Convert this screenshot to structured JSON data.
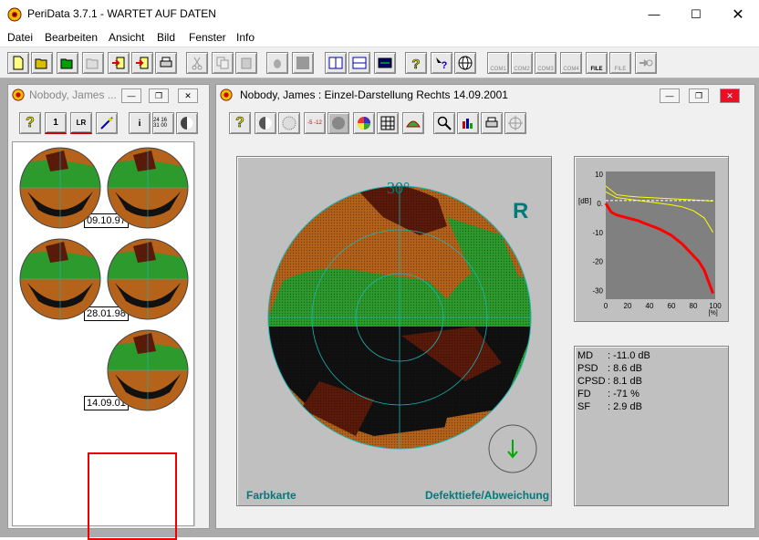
{
  "window": {
    "title": "PeriData 3.7.1 - WARTET AUF DATEN"
  },
  "menu": [
    "Datei",
    "Bearbeiten",
    "Ansicht",
    "Bild",
    "Fenster",
    "Info"
  ],
  "toolbar": {
    "com_buttons": [
      "COM1",
      "COM2",
      "COM3",
      "COM4",
      "FILE",
      "FILE"
    ]
  },
  "left_window": {
    "title": "Nobody, James ...",
    "buttons": [
      "?",
      "1",
      "LR",
      "i",
      "24 16 31 00"
    ],
    "thumbs": [
      {
        "date": "09.10.97"
      },
      {
        "date": "28.01.98"
      },
      {
        "date": "14.09.01"
      }
    ]
  },
  "right_window": {
    "title": "Nobody, James :  Einzel-Darstellung  Rechts  14.09.2001",
    "toolbar": [
      "?",
      "-5 -12"
    ],
    "map": {
      "angle": "30°",
      "eye": "R",
      "left_label": "Farbkarte",
      "right_label": "Defekttiefe/Abweichung"
    },
    "chart_data": {
      "type": "line",
      "title": "",
      "xlabel": "[%]",
      "ylabel": "[dB]",
      "xlim": [
        0,
        100
      ],
      "ylim": [
        -33,
        11
      ],
      "x_ticks": [
        "0",
        "20",
        "40",
        "60",
        "80",
        "100"
      ],
      "y_ticks": [
        "10",
        "0.",
        "-10",
        "-20",
        "-30"
      ],
      "series": [
        {
          "color": "#ff0000",
          "x": [
            0,
            5,
            10,
            15,
            20,
            25,
            30,
            35,
            40,
            45,
            50,
            55,
            60,
            65,
            70,
            75,
            80,
            85,
            90,
            95,
            98
          ],
          "y": [
            0,
            -3,
            -4,
            -4.5,
            -5,
            -5.5,
            -6,
            -6.8,
            -7.5,
            -8.2,
            -9,
            -10,
            -11,
            -12.5,
            -14,
            -16,
            -18,
            -20,
            -23,
            -28,
            -31
          ]
        },
        {
          "color": "#ffff00",
          "x": [
            0,
            10,
            20,
            30,
            40,
            50,
            60,
            70,
            80,
            90,
            98
          ],
          "y": [
            4,
            2,
            1.5,
            1,
            0.5,
            0,
            -0.5,
            -1.2,
            -2.5,
            -5,
            -10
          ]
        },
        {
          "color": "#ffff00",
          "x": [
            0,
            10,
            20,
            30,
            40,
            50,
            60,
            70,
            80,
            90,
            98
          ],
          "y": [
            6,
            3,
            2.5,
            2.2,
            2,
            1.8,
            1.6,
            1.4,
            1.2,
            1,
            0.8
          ]
        },
        {
          "color": "#ffffff",
          "dashed": true,
          "x": [
            0,
            98
          ],
          "y": [
            1,
            1
          ]
        }
      ]
    },
    "stats": [
      {
        "k": "MD",
        "v": ": -11.0 dB"
      },
      {
        "k": "PSD",
        "v": ": 8.6 dB"
      },
      {
        "k": "CPSD",
        "v": ": 8.1 dB"
      },
      {
        "k": "FD",
        "v": ": -71 %"
      },
      {
        "k": "SF",
        "v": ": 2.9 dB"
      }
    ]
  }
}
